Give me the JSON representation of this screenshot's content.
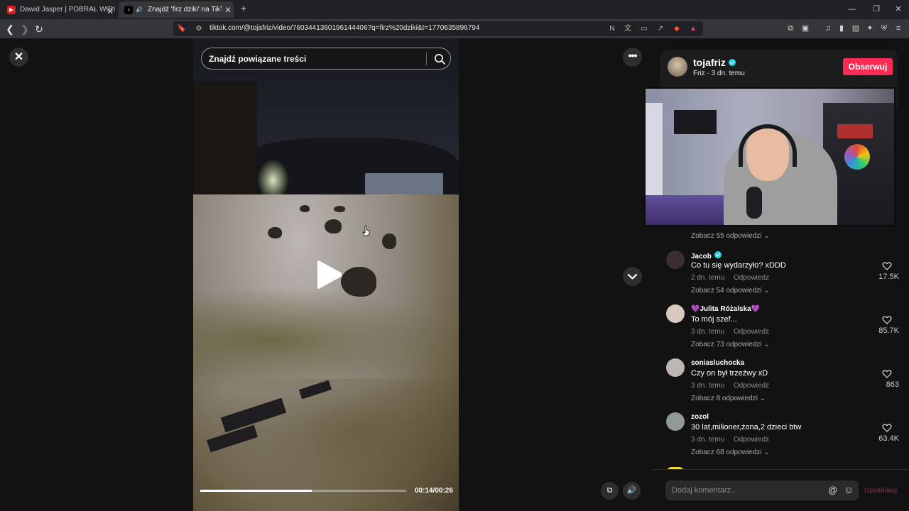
{
  "browser": {
    "tabs": [
      {
        "title": "Dawid Jasper | POBRAŁ WIRUSA - Yo",
        "active": false,
        "icon": "youtube-icon"
      },
      {
        "title": "Znajdź 'firz dziki' na TikTok | V",
        "active": true,
        "icon": "tiktok-icon"
      }
    ],
    "url": "tiktok.com/@tojafriz/video/7603441360196144406?q=firz%20dziki&t=1770635896794"
  },
  "video": {
    "search_placeholder": "Znajdź powiązane treści",
    "time": "00:14/00:26",
    "progress": 0.54
  },
  "author": {
    "name": "tojafriz",
    "subline": "Friz · 3 dn. temu",
    "follow_label": "Obserwuj",
    "verified": true
  },
  "comments": {
    "top_see_more": "Zobacz 55 odpowiedzi",
    "items": [
      {
        "user": "Jacob",
        "verified": true,
        "text": "Co tu się wydarzyło? xDDD",
        "time": "2 dn. temu",
        "reply": "Odpowiedz",
        "likes": "17.5K",
        "see_more": "Zobacz 54 odpowiedzi",
        "avatar_color": "#3a2f2f"
      },
      {
        "user": "💜Julita Różalska💜",
        "verified": false,
        "text": "To mój szef...",
        "time": "3 dn. temu",
        "reply": "Odpowiedz",
        "likes": "85.7K",
        "see_more": "Zobacz 73 odpowiedzi",
        "avatar_color": "#d9c8c0"
      },
      {
        "user": "soniasluchocka",
        "verified": false,
        "text": "Czy on był trzeźwy xD",
        "time": "3 dn. temu",
        "reply": "Odpowiedz",
        "likes": "863",
        "see_more": "Zobacz 8 odpowiedzi",
        "avatar_color": "#bdb6b2"
      },
      {
        "user": "zozol",
        "verified": false,
        "text": "30 lat,milioner,żona,2 dzieci btw",
        "time": "3 dn. temu",
        "reply": "Odpowiedz",
        "likes": "63.4K",
        "see_more": "Zobacz 68 odpowiedzi",
        "avatar_color": "#8f9a98"
      }
    ],
    "input_placeholder": "Dodaj komentarz...",
    "post_label": "Opublikuj"
  }
}
